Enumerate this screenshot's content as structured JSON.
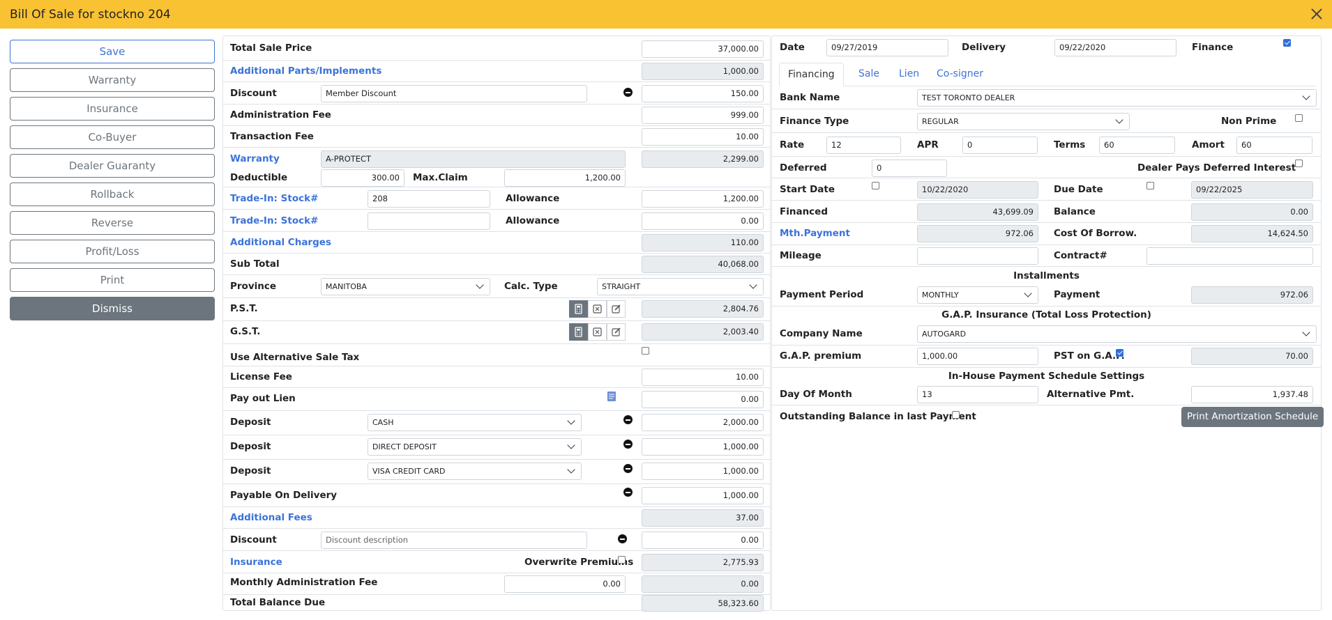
{
  "window": {
    "title": "Bill Of Sale for stockno 204"
  },
  "sidebar": {
    "save": "Save",
    "warranty": "Warranty",
    "insurance": "Insurance",
    "cobuyer": "Co-Buyer",
    "dealer_guaranty": "Dealer Guaranty",
    "rollback": "Rollback",
    "reverse": "Reverse",
    "profit_loss": "Profit/Loss",
    "print": "Print",
    "dismiss": "Dismiss"
  },
  "sale": {
    "total_sale_price": {
      "label": "Total Sale Price",
      "value": "37,000.00"
    },
    "additional_parts": {
      "label": "Additional Parts/Implements",
      "value": "1,000.00"
    },
    "discount1": {
      "label": "Discount",
      "description": "Member Discount",
      "value": "150.00"
    },
    "admin_fee": {
      "label": "Administration Fee",
      "value": "999.00"
    },
    "transaction_fee": {
      "label": "Transaction Fee",
      "value": "10.00"
    },
    "warranty": {
      "label": "Warranty",
      "name": "A-PROTECT",
      "value": "2,299.00",
      "deductible_label": "Deductible",
      "deductible": "300.00",
      "maxclaim_label": "Max.Claim",
      "maxclaim": "1,200.00"
    },
    "tradein1": {
      "label": "Trade-In: Stock#",
      "stock": "208",
      "allowance_label": "Allowance",
      "allowance": "1,200.00"
    },
    "tradein2": {
      "label": "Trade-In: Stock#",
      "stock": "",
      "allowance_label": "Allowance",
      "allowance": "0.00"
    },
    "additional_charges": {
      "label": "Additional Charges",
      "value": "110.00"
    },
    "sub_total": {
      "label": "Sub Total",
      "value": "40,068.00"
    },
    "province": {
      "label": "Province",
      "value": "MANITOBA",
      "calc_label": "Calc. Type",
      "calc_value": "STRAIGHT"
    },
    "pst": {
      "label": "P.S.T.",
      "value": "2,804.76"
    },
    "gst": {
      "label": "G.S.T.",
      "value": "2,003.40"
    },
    "alt_sale_tax": {
      "label": "Use Alternative Sale Tax",
      "checked": false
    },
    "license_fee": {
      "label": "License Fee",
      "value": "10.00"
    },
    "payout_lien": {
      "label": "Pay out Lien",
      "value": "0.00"
    },
    "deposits": [
      {
        "label": "Deposit",
        "method": "CASH",
        "value": "2,000.00"
      },
      {
        "label": "Deposit",
        "method": "DIRECT DEPOSIT",
        "value": "1,000.00"
      },
      {
        "label": "Deposit",
        "method": "VISA CREDIT CARD",
        "value": "1,000.00"
      }
    ],
    "payable_on_delivery": {
      "label": "Payable On Delivery",
      "value": "1,000.00"
    },
    "additional_fees": {
      "label": "Additional Fees",
      "value": "37.00"
    },
    "discount2": {
      "label": "Discount",
      "placeholder": "Discount description",
      "value": "0.00"
    },
    "insurance": {
      "label": "Insurance",
      "overwrite_label": "Overwrite Premiums",
      "value": "2,775.93"
    },
    "monthly_admin_fee": {
      "label": "Monthly Administration Fee",
      "input": "0.00",
      "value": "0.00"
    },
    "total_balance_due": {
      "label": "Total Balance Due",
      "value": "58,323.60"
    }
  },
  "finance": {
    "date_label": "Date",
    "date": "09/27/2019",
    "delivery_label": "Delivery",
    "delivery": "09/22/2020",
    "finance_label": "Finance",
    "finance_checked": true,
    "tabs": [
      "Financing",
      "Sale",
      "Lien",
      "Co-signer"
    ],
    "bank_label": "Bank Name",
    "bank": "TEST TORONTO DEALER",
    "finance_type_label": "Finance Type",
    "finance_type": "REGULAR",
    "non_prime_label": "Non Prime",
    "rate_label": "Rate",
    "rate": "12",
    "apr_label": "APR",
    "apr": "0",
    "terms_label": "Terms",
    "terms": "60",
    "amort_label": "Amort",
    "amort": "60",
    "deferred_label": "Deferred",
    "deferred": "0",
    "dealer_pays_label": "Dealer Pays Deferred Interest",
    "start_date_label": "Start Date",
    "start_date": "10/22/2020",
    "due_date_label": "Due Date",
    "due_date": "09/22/2025",
    "financed_label": "Financed",
    "financed": "43,699.09",
    "balance_label": "Balance",
    "balance": "0.00",
    "mth_payment_label": "Mth.Payment",
    "mth_payment": "972.06",
    "cost_borrow_label": "Cost Of Borrow.",
    "cost_borrow": "14,624.50",
    "mileage_label": "Mileage",
    "mileage": "",
    "contract_label": "Contract#",
    "contract": "",
    "installments_heading": "Installments",
    "payment_period_label": "Payment Period",
    "payment_period": "MONTHLY",
    "payment_label": "Payment",
    "payment": "972.06",
    "gap_heading": "G.A.P. Insurance (Total Loss Protection)",
    "company_label": "Company Name",
    "company": "AUTOGARD",
    "gap_premium_label": "G.A.P. premium",
    "gap_premium": "1,000.00",
    "pst_gap_label": "PST on G.A.P.",
    "pst_gap_checked": true,
    "pst_gap": "70.00",
    "inhouse_heading": "In-House Payment Schedule Settings",
    "day_of_month_label": "Day Of Month",
    "day_of_month": "13",
    "alt_pmt_label": "Alternative Pmt.",
    "alt_pmt": "1,937.48",
    "outstanding_label": "Outstanding Balance in last Payment",
    "print_amort": "Print Amortization Schedule"
  }
}
